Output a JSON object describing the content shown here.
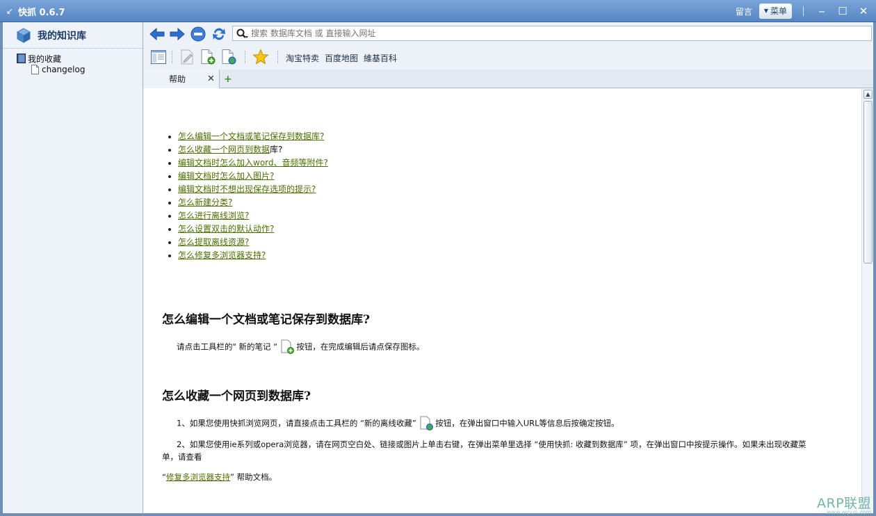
{
  "window": {
    "title": "快抓 0.6.7",
    "comment_link": "留言",
    "menu_label": "菜单"
  },
  "sidebar": {
    "title": "我的知识库",
    "tree": [
      {
        "label": "我的收藏"
      },
      {
        "label": "changelog"
      }
    ]
  },
  "search": {
    "placeholder": "搜索 数据库文档 或 直接输入网址"
  },
  "bookmarks": [
    "淘宝特卖",
    "百度地图",
    "維基百科"
  ],
  "tab": {
    "label": "帮助"
  },
  "help": {
    "toc": [
      {
        "text": "怎么编辑一个文档或笔记保存到数据库?",
        "link": true
      },
      {
        "link_text": "怎么收藏一个网页到数据",
        "rest": "库?"
      },
      {
        "text": "编辑文档时怎么加入word、音频等附件?",
        "link": true
      },
      {
        "text": "编辑文档时怎么加入图片?",
        "link": true
      },
      {
        "text": "编辑文档时不想出现保存选项的提示?",
        "link": true
      },
      {
        "text": "怎么新建分类?",
        "link": true
      },
      {
        "text": "怎么进行离线浏览?",
        "link": true
      },
      {
        "text": "怎么设置双击的默认动作?",
        "link": true
      },
      {
        "text": "怎么提取离线资源?",
        "link": true
      },
      {
        "text": "怎么修复多浏览器支持?",
        "link": true
      }
    ],
    "section1": {
      "heading": "怎么编辑一个文档或笔记保存到数据库?",
      "text_before": "请点击工具栏的\" 新的笔记 “",
      "text_after": "按钮，在完成编辑后请点保存图标。"
    },
    "section2": {
      "heading": "怎么收藏一个网页到数据库?",
      "p1_before": "1、如果您使用快抓浏览网页，请直接点击工具栏的 “新的离线收藏”",
      "p1_after": "按钮，在弹出窗口中输入URL等信息后按确定按钮。",
      "p2_line1": "2、如果您使用ie系列或opera浏览器，请在网页空白处、链接或图片上单击右键，在弹出菜单里选择 “使用快抓: 收藏到数据库” 项，在弹出窗口中按提示操作。如果未出现收藏菜",
      "p2_line2": "单，请查看",
      "p3_open": "“",
      "p3_link": "修复多浏览器支持",
      "p3_after": "” 帮助文档。"
    }
  },
  "watermark": {
    "main": "ARP联盟",
    "sub": "www.arpun.com"
  },
  "colors": {
    "titlebar": "#5c8bc8",
    "link": "#4d6e00",
    "sidebar_bg": "#eef3fa"
  }
}
